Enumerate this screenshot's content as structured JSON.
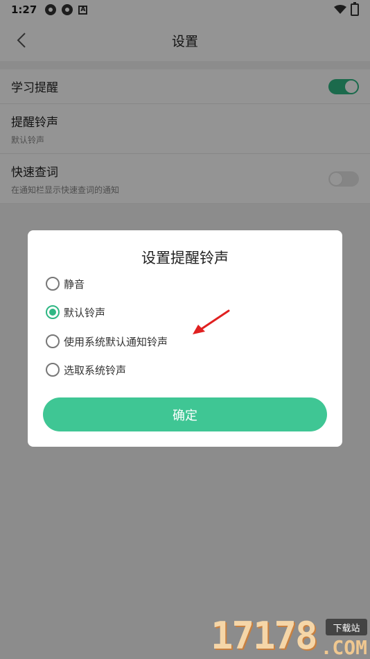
{
  "status_bar": {
    "time": "1:27",
    "notif_icons": [
      "settings-icon",
      "settings-icon",
      "a-icon"
    ]
  },
  "app_bar": {
    "title": "设置"
  },
  "settings": {
    "study_reminder": {
      "label": "学习提醒",
      "enabled": true
    },
    "ringtone": {
      "label": "提醒铃声",
      "value": "默认铃声"
    },
    "quick_lookup": {
      "label": "快速查词",
      "description": "在通知栏显示快速查词的通知",
      "enabled": false
    }
  },
  "dialog": {
    "title": "设置提醒铃声",
    "options": [
      {
        "label": "静音",
        "checked": false
      },
      {
        "label": "默认铃声",
        "checked": true
      },
      {
        "label": "使用系统默认通知铃声",
        "checked": false
      },
      {
        "label": "选取系统铃声",
        "checked": false
      }
    ],
    "confirm_label": "确定"
  },
  "colors": {
    "accent": "#3fc694",
    "toggle_on": "#2fb784",
    "annotation_arrow": "#e02020"
  },
  "watermark": {
    "digits": "17178",
    "tag": "下载站",
    "domain": ".COM"
  }
}
